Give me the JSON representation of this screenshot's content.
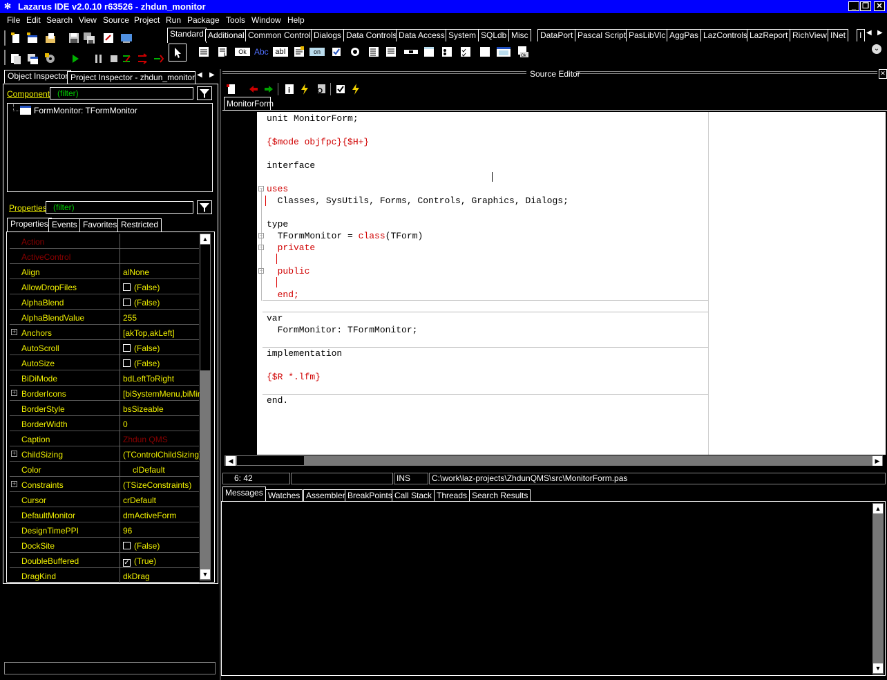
{
  "window": {
    "title": "Lazarus IDE v2.0.10 r63526 - zhdun_monitor",
    "buttons": [
      "_",
      "❐",
      "✕"
    ]
  },
  "menu": [
    "File",
    "Edit",
    "Search",
    "View",
    "Source",
    "Project",
    "Run",
    "Package",
    "Tools",
    "Window",
    "Help"
  ],
  "palette": {
    "tabs": [
      "Standard",
      "Additional",
      "Common Controls",
      "Dialogs",
      "Data Controls",
      "Data Access",
      "System",
      "SQLdb",
      "Misc",
      "DataPort",
      "Pascal Script",
      "PasLibVlc",
      "AggPas",
      "LazControls",
      "LazReport",
      "RichView",
      "INet",
      "I"
    ],
    "active_tab": "Standard",
    "component_labels": {
      "ok": "Ok",
      "abc": "Abc",
      "abi": "abI",
      "on": "on"
    }
  },
  "inspector": {
    "tabs": [
      "Object Inspector",
      "Project Inspector - zhdun_monitor [Def"
    ],
    "components_label": "Components",
    "components_filter": "(filter)",
    "tree_item": "FormMonitor: TFormMonitor",
    "properties_label": "Properties",
    "properties_filter": "(filter)",
    "prop_tabs": [
      "Properties",
      "Events",
      "Favorites",
      "Restricted"
    ],
    "rows": [
      {
        "name": "Action",
        "value": "",
        "readonly": true
      },
      {
        "name": "ActiveControl",
        "value": "",
        "readonly": true
      },
      {
        "name": "Align",
        "value": "alNone"
      },
      {
        "name": "AllowDropFiles",
        "value": "(False)",
        "check": false
      },
      {
        "name": "AlphaBlend",
        "value": "(False)",
        "check": false
      },
      {
        "name": "AlphaBlendValue",
        "value": "255"
      },
      {
        "name": "Anchors",
        "value": "[akTop,akLeft]",
        "expand": true
      },
      {
        "name": "AutoScroll",
        "value": "(False)",
        "check": false
      },
      {
        "name": "AutoSize",
        "value": "(False)",
        "check": false
      },
      {
        "name": "BiDiMode",
        "value": "bdLeftToRight"
      },
      {
        "name": "BorderIcons",
        "value": "[biSystemMenu,biMinim",
        "expand": true
      },
      {
        "name": "BorderStyle",
        "value": "bsSizeable"
      },
      {
        "name": "BorderWidth",
        "value": "0"
      },
      {
        "name": "Caption",
        "value": "Zhdun QMS",
        "red": true
      },
      {
        "name": "ChildSizing",
        "value": "(TControlChildSizing)",
        "expand": true
      },
      {
        "name": "Color",
        "value": "clDefault",
        "swatch": true
      },
      {
        "name": "Constraints",
        "value": "(TSizeConstraints)",
        "expand": true
      },
      {
        "name": "Cursor",
        "value": "crDefault"
      },
      {
        "name": "DefaultMonitor",
        "value": "dmActiveForm"
      },
      {
        "name": "DesignTimePPI",
        "value": "96"
      },
      {
        "name": "DockSite",
        "value": "(False)",
        "check": false
      },
      {
        "name": "DoubleBuffered",
        "value": "(True)",
        "check": true
      },
      {
        "name": "DragKind",
        "value": "dkDrag"
      }
    ]
  },
  "editor": {
    "header": "Source Editor",
    "tab": "MonitorForm",
    "code": {
      "l1": "unit MonitorForm;",
      "l2": "{$mode objfpc}{$H+}",
      "l3": "interface",
      "l4": "uses",
      "l5": "  Classes, SysUtils, Forms, Controls, Graphics, Dialogs;",
      "l6": "type",
      "l7a": "  TFormMonitor = ",
      "l7b": "class",
      "l7c": "(TForm)",
      "l8": "  private",
      "l9": "  public",
      "l10": "  end;",
      "l11": "var",
      "l12": "  FormMonitor: TFormMonitor;",
      "l13": "implementation",
      "l14": "{$R *.lfm}",
      "l15": "end."
    },
    "status": {
      "position": "6: 42",
      "mode": "INS",
      "file": "C:\\work\\laz-projects\\ZhdunQMS\\src\\MonitorForm.pas"
    }
  },
  "messages": {
    "tabs": [
      "Messages",
      "Watches",
      "Assembler",
      "BreakPoints",
      "Call Stack",
      "Threads",
      "Search Results"
    ],
    "active_tab": "Messages"
  },
  "colors": {
    "titlebar": "#0000ff",
    "background": "#000000",
    "text": "#ffffff",
    "property_text": "#f0f000",
    "readonly_text": "#8b0000",
    "filter_text": "#00d000",
    "code_keyword": "#d00000"
  }
}
